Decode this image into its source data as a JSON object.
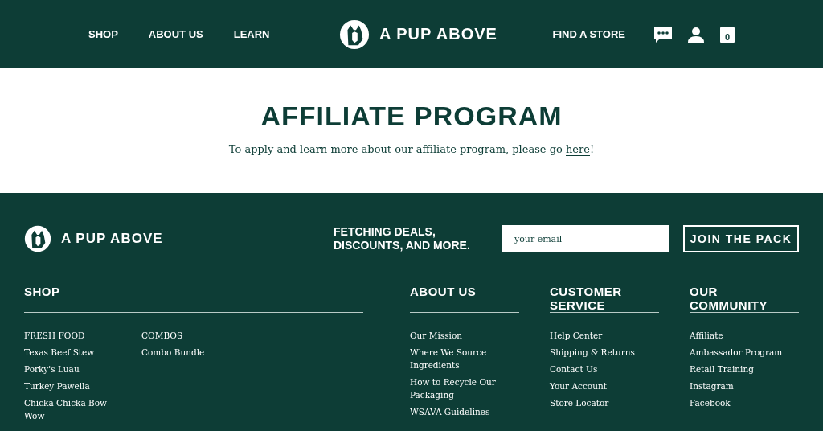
{
  "header": {
    "nav_left": [
      "SHOP",
      "ABOUT US",
      "LEARN"
    ],
    "brand": "A PUP ABOVE",
    "nav_right": [
      "FIND A STORE"
    ],
    "cart_count": "0"
  },
  "main": {
    "title": "AFFILIATE PROGRAM",
    "text_before": "To apply and learn more about our affiliate program, please go ",
    "link": "here",
    "text_after": "!"
  },
  "footer": {
    "brand": "A PUP ABOVE",
    "newsletter_title": "FETCHING DEALS, DISCOUNTS, AND MORE.",
    "email_placeholder": "your email",
    "join_button": "JOIN THE PACK",
    "shop": {
      "title": "SHOP",
      "columns": [
        [
          "FRESH FOOD",
          "Texas Beef Stew",
          "Porky's Luau",
          "Turkey Pawella",
          "Chicka Chicka Bow Wow"
        ],
        [
          "COMBOS",
          "Combo Bundle"
        ]
      ]
    },
    "sections": [
      {
        "title": "ABOUT US",
        "links": [
          "Our Mission",
          "Where We Source Ingredients",
          "How to Recycle Our Packaging",
          "WSAVA Guidelines"
        ]
      },
      {
        "title": "CUSTOMER SERVICE",
        "links": [
          "Help Center",
          "Shipping & Returns",
          "Contact Us",
          "Your Account",
          "Store Locator"
        ]
      },
      {
        "title": "OUR COMMUNITY",
        "links": [
          "Affiliate",
          "Ambassador Program",
          "Retail Training",
          "Instagram",
          "Facebook"
        ]
      }
    ]
  }
}
